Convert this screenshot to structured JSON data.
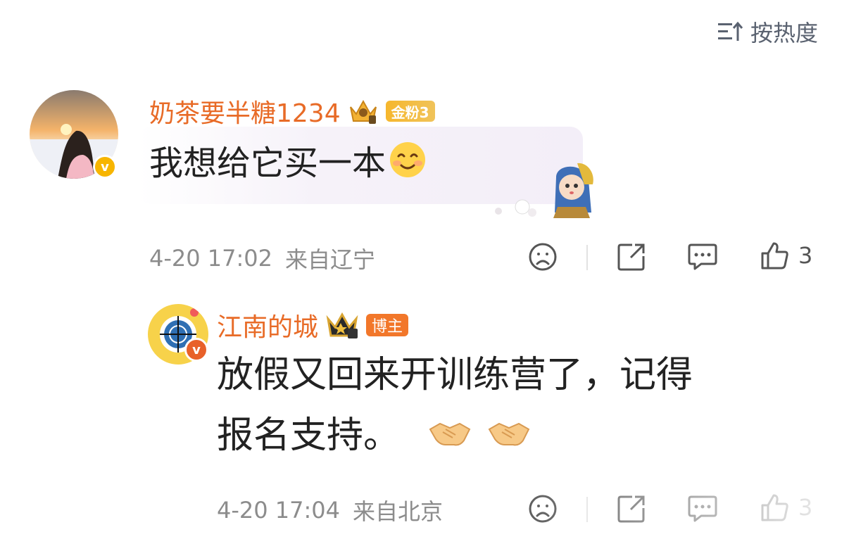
{
  "sort": {
    "label": "按热度",
    "icon": "sort-icon"
  },
  "comments": [
    {
      "username": "奶茶要半糖1234",
      "fan_badge": "金粉3",
      "verified": "v",
      "text": "我想给它买一本",
      "emoji": "smile-emoji",
      "time": "4-20 17:02",
      "location": "来自辽宁",
      "likes": "3"
    },
    {
      "username": "江南的城",
      "role_badge": "博主",
      "verified": "v",
      "text_line1": "放假又回来开训练营了，记得",
      "text_line2": "报名支持。",
      "emoji": "handshake-emoji",
      "time": "4-20 17:04",
      "location": "来自北京",
      "likes": "3"
    }
  ],
  "colors": {
    "username": "#e86b27",
    "meta": "#8c8c8c",
    "badge_gold": "#f6b72d",
    "badge_orange": "#f2772a"
  }
}
